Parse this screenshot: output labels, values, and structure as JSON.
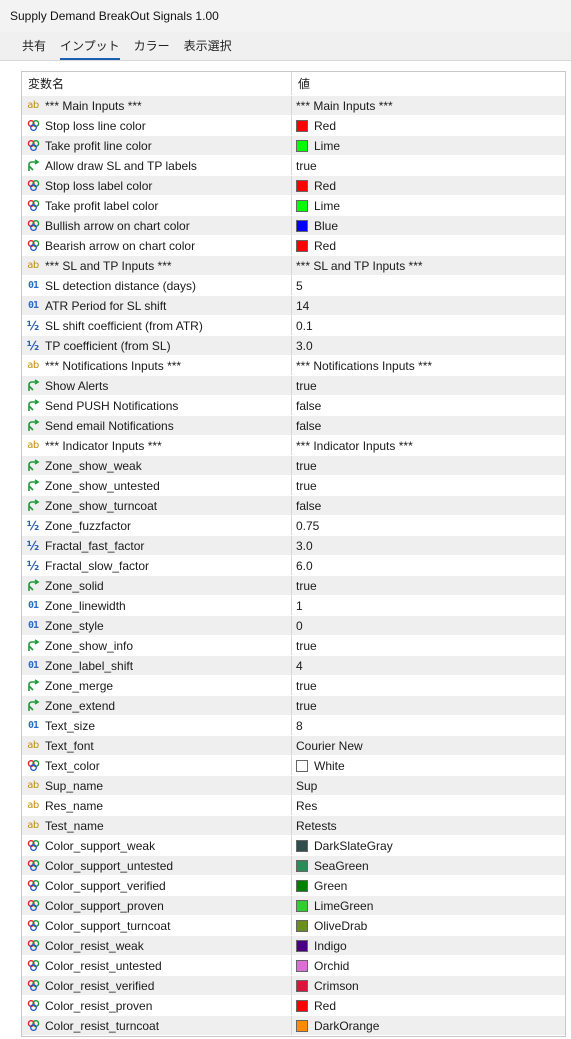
{
  "window": {
    "title": "Supply Demand BreakOut Signals 1.00"
  },
  "tabs": [
    {
      "label": "共有",
      "active": false
    },
    {
      "label": "インプット",
      "active": true
    },
    {
      "label": "カラー",
      "active": false
    },
    {
      "label": "表示選択",
      "active": false
    }
  ],
  "table": {
    "headers": {
      "name": "変数名",
      "value": "値"
    },
    "rows": [
      {
        "type": "string",
        "icon": "string-icon",
        "name": "*** Main Inputs ***",
        "value": "*** Main Inputs ***"
      },
      {
        "type": "color",
        "icon": "color-icon",
        "name": "Stop loss line color",
        "value": "Red",
        "color": "#ff0000"
      },
      {
        "type": "color",
        "icon": "color-icon",
        "name": "Take profit line color",
        "value": "Lime",
        "color": "#00ff00"
      },
      {
        "type": "bool",
        "icon": "bool-icon",
        "name": "Allow draw SL and TP labels",
        "value": "true"
      },
      {
        "type": "color",
        "icon": "color-icon",
        "name": "Stop loss label color",
        "value": "Red",
        "color": "#ff0000"
      },
      {
        "type": "color",
        "icon": "color-icon",
        "name": "Take profit label color",
        "value": "Lime",
        "color": "#00ff00"
      },
      {
        "type": "color",
        "icon": "color-icon",
        "name": "Bullish arrow on chart color",
        "value": "Blue",
        "color": "#0000ff"
      },
      {
        "type": "color",
        "icon": "color-icon",
        "name": "Bearish arrow on chart color",
        "value": "Red",
        "color": "#ff0000"
      },
      {
        "type": "string",
        "icon": "string-icon",
        "name": "*** SL and TP Inputs ***",
        "value": "*** SL and TP Inputs ***"
      },
      {
        "type": "int",
        "icon": "integer-icon",
        "name": "SL detection distance (days)",
        "value": "5"
      },
      {
        "type": "int",
        "icon": "integer-icon",
        "name": "ATR Period for SL shift",
        "value": "14"
      },
      {
        "type": "double",
        "icon": "double-icon",
        "name": "SL shift coefficient (from ATR)",
        "value": "0.1"
      },
      {
        "type": "double",
        "icon": "double-icon",
        "name": "TP coefficient (from SL)",
        "value": "3.0"
      },
      {
        "type": "string",
        "icon": "string-icon",
        "name": "*** Notifications Inputs ***",
        "value": "*** Notifications Inputs ***"
      },
      {
        "type": "bool",
        "icon": "bool-icon",
        "name": "Show Alerts",
        "value": "true"
      },
      {
        "type": "bool",
        "icon": "bool-icon",
        "name": "Send PUSH Notifications",
        "value": "false"
      },
      {
        "type": "bool",
        "icon": "bool-icon",
        "name": "Send email Notifications",
        "value": "false"
      },
      {
        "type": "string",
        "icon": "string-icon",
        "name": "*** Indicator Inputs ***",
        "value": "*** Indicator Inputs ***"
      },
      {
        "type": "bool",
        "icon": "bool-icon",
        "name": "Zone_show_weak",
        "value": "true"
      },
      {
        "type": "bool",
        "icon": "bool-icon",
        "name": "Zone_show_untested",
        "value": "true"
      },
      {
        "type": "bool",
        "icon": "bool-icon",
        "name": "Zone_show_turncoat",
        "value": "false"
      },
      {
        "type": "double",
        "icon": "double-icon",
        "name": "Zone_fuzzfactor",
        "value": "0.75"
      },
      {
        "type": "double",
        "icon": "double-icon",
        "name": "Fractal_fast_factor",
        "value": "3.0"
      },
      {
        "type": "double",
        "icon": "double-icon",
        "name": "Fractal_slow_factor",
        "value": "6.0"
      },
      {
        "type": "bool",
        "icon": "bool-icon",
        "name": "Zone_solid",
        "value": "true"
      },
      {
        "type": "int",
        "icon": "integer-icon",
        "name": "Zone_linewidth",
        "value": "1"
      },
      {
        "type": "int",
        "icon": "integer-icon",
        "name": "Zone_style",
        "value": "0"
      },
      {
        "type": "bool",
        "icon": "bool-icon",
        "name": "Zone_show_info",
        "value": "true"
      },
      {
        "type": "int",
        "icon": "integer-icon",
        "name": "Zone_label_shift",
        "value": "4"
      },
      {
        "type": "bool",
        "icon": "bool-icon",
        "name": "Zone_merge",
        "value": "true"
      },
      {
        "type": "bool",
        "icon": "bool-icon",
        "name": "Zone_extend",
        "value": "true"
      },
      {
        "type": "int",
        "icon": "integer-icon",
        "name": "Text_size",
        "value": "8"
      },
      {
        "type": "string",
        "icon": "string-icon",
        "name": "Text_font",
        "value": "Courier New"
      },
      {
        "type": "color",
        "icon": "color-icon",
        "name": "Text_color",
        "value": "White",
        "color": "#ffffff"
      },
      {
        "type": "string",
        "icon": "string-icon",
        "name": "Sup_name",
        "value": "Sup"
      },
      {
        "type": "string",
        "icon": "string-icon",
        "name": "Res_name",
        "value": "Res"
      },
      {
        "type": "string",
        "icon": "string-icon",
        "name": "Test_name",
        "value": "Retests"
      },
      {
        "type": "color",
        "icon": "color-icon",
        "name": "Color_support_weak",
        "value": "DarkSlateGray",
        "color": "#2f4f4f"
      },
      {
        "type": "color",
        "icon": "color-icon",
        "name": "Color_support_untested",
        "value": "SeaGreen",
        "color": "#2e8b57"
      },
      {
        "type": "color",
        "icon": "color-icon",
        "name": "Color_support_verified",
        "value": "Green",
        "color": "#008000"
      },
      {
        "type": "color",
        "icon": "color-icon",
        "name": "Color_support_proven",
        "value": "LimeGreen",
        "color": "#32cd32"
      },
      {
        "type": "color",
        "icon": "color-icon",
        "name": "Color_support_turncoat",
        "value": "OliveDrab",
        "color": "#6b8e23"
      },
      {
        "type": "color",
        "icon": "color-icon",
        "name": "Color_resist_weak",
        "value": "Indigo",
        "color": "#4b0082"
      },
      {
        "type": "color",
        "icon": "color-icon",
        "name": "Color_resist_untested",
        "value": "Orchid",
        "color": "#da70d6"
      },
      {
        "type": "color",
        "icon": "color-icon",
        "name": "Color_resist_verified",
        "value": "Crimson",
        "color": "#dc143c"
      },
      {
        "type": "color",
        "icon": "color-icon",
        "name": "Color_resist_proven",
        "value": "Red",
        "color": "#ff0000"
      },
      {
        "type": "color",
        "icon": "color-icon",
        "name": "Color_resist_turncoat",
        "value": "DarkOrange",
        "color": "#ff8c00"
      }
    ]
  }
}
